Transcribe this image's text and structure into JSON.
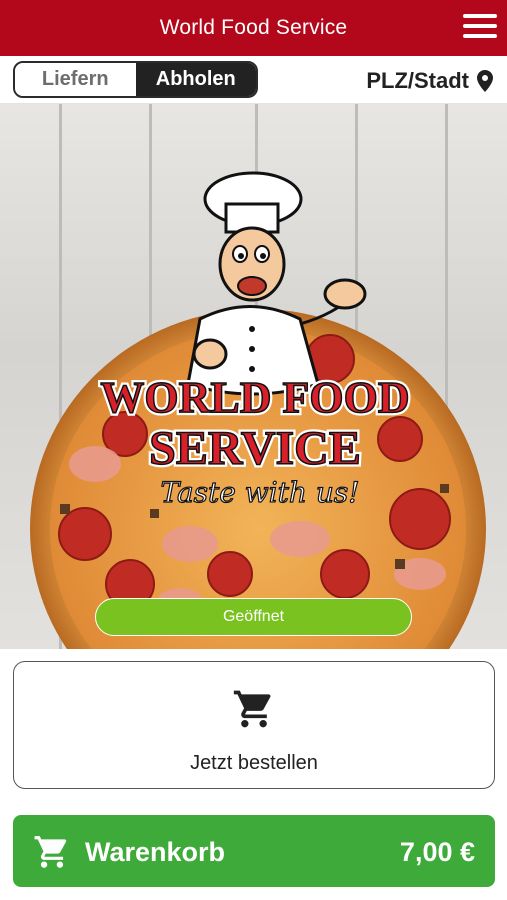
{
  "header": {
    "title": "World Food Service",
    "menu_icon": "hamburger-menu-icon"
  },
  "mode_toggle": {
    "options": [
      {
        "label": "Liefern",
        "selected": false
      },
      {
        "label": "Abholen",
        "selected": true
      }
    ]
  },
  "location": {
    "label": "PLZ/Stadt",
    "icon": "location-pin-icon"
  },
  "hero": {
    "logo_lines": [
      "WORLD FOOD",
      "SERVICE"
    ],
    "slogan": "Taste with us!",
    "status": "Geöffnet"
  },
  "order": {
    "label": "Jetzt bestellen",
    "icon": "cart-icon"
  },
  "cart": {
    "label": "Warenkorb",
    "price": "7,00 €",
    "icon": "cart-icon"
  },
  "colors": {
    "brand_red": "#b3081c",
    "status_green": "#7ac21f",
    "cart_green": "#3daa3a",
    "dark": "#222222"
  }
}
